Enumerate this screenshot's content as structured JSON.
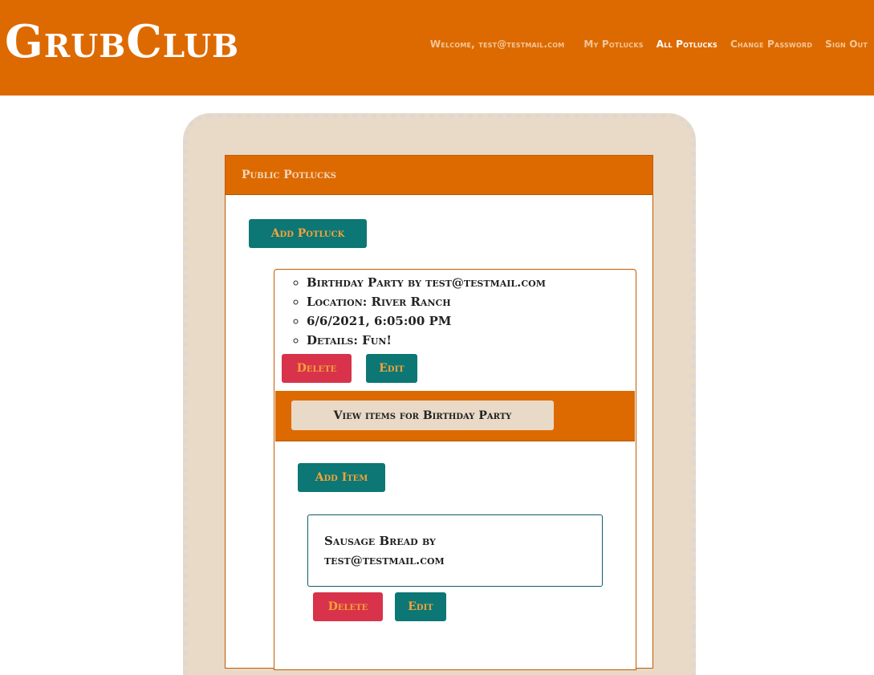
{
  "header": {
    "brand": "GrubClub",
    "nav": {
      "welcome": "Welcome, test@testmail.com",
      "my_potlucks": "My Potlucks",
      "all_potlucks": "All Potlucks",
      "change_password": "Change Password",
      "sign_out": "Sign Out"
    }
  },
  "colors": {
    "header_bg": "#dd6a00",
    "frame_bg": "#e9d9c7",
    "teal_button": "#0c7775",
    "red_button": "#d8334a",
    "button_text": "#f5a23a"
  },
  "card": {
    "title": "Public Potlucks",
    "add_potluck_label": "Add Potluck"
  },
  "potluck": {
    "details": [
      "Birthday Party by test@testmail.com",
      "Location: River Ranch",
      "6/6/2021, 6:05:00 PM",
      "Details: Fun!"
    ],
    "delete_label": "Delete",
    "edit_label": "Edit",
    "view_items_label": "View items for Birthday Party",
    "add_item_label": "Add Item",
    "items": [
      {
        "text": "Sausage Bread by test@testmail.com",
        "delete_label": "Delete",
        "edit_label": "Edit"
      }
    ]
  }
}
